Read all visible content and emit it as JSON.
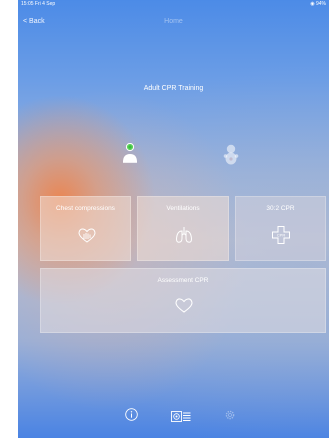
{
  "status_bar": {
    "time": "15:05  Fri 4 Sep",
    "right": "◉ 94%"
  },
  "nav": {
    "back_label": "< Back",
    "title": "Home"
  },
  "heading": "Adult CPR Training",
  "modes": [
    {
      "name": "adult",
      "icon": "person-icon",
      "selected": true
    },
    {
      "name": "child",
      "icon": "baby-icon",
      "selected": false
    }
  ],
  "tiles": [
    {
      "label": "Chest compressions",
      "icon": "heart-hand-icon"
    },
    {
      "label": "Ventilations",
      "icon": "lungs-icon"
    },
    {
      "label": "30:2 CPR",
      "icon": "cpr-cross-icon"
    },
    {
      "label": "Assessment CPR",
      "icon": "heart-outline-icon"
    }
  ],
  "toolbar": [
    {
      "icon": "info-icon"
    },
    {
      "icon": "device-settings-icon"
    },
    {
      "icon": "gear-icon"
    }
  ],
  "colors": {
    "indicator": "#5fd35f",
    "top_blue": "#4c8be7",
    "glow": "#ec844e"
  }
}
